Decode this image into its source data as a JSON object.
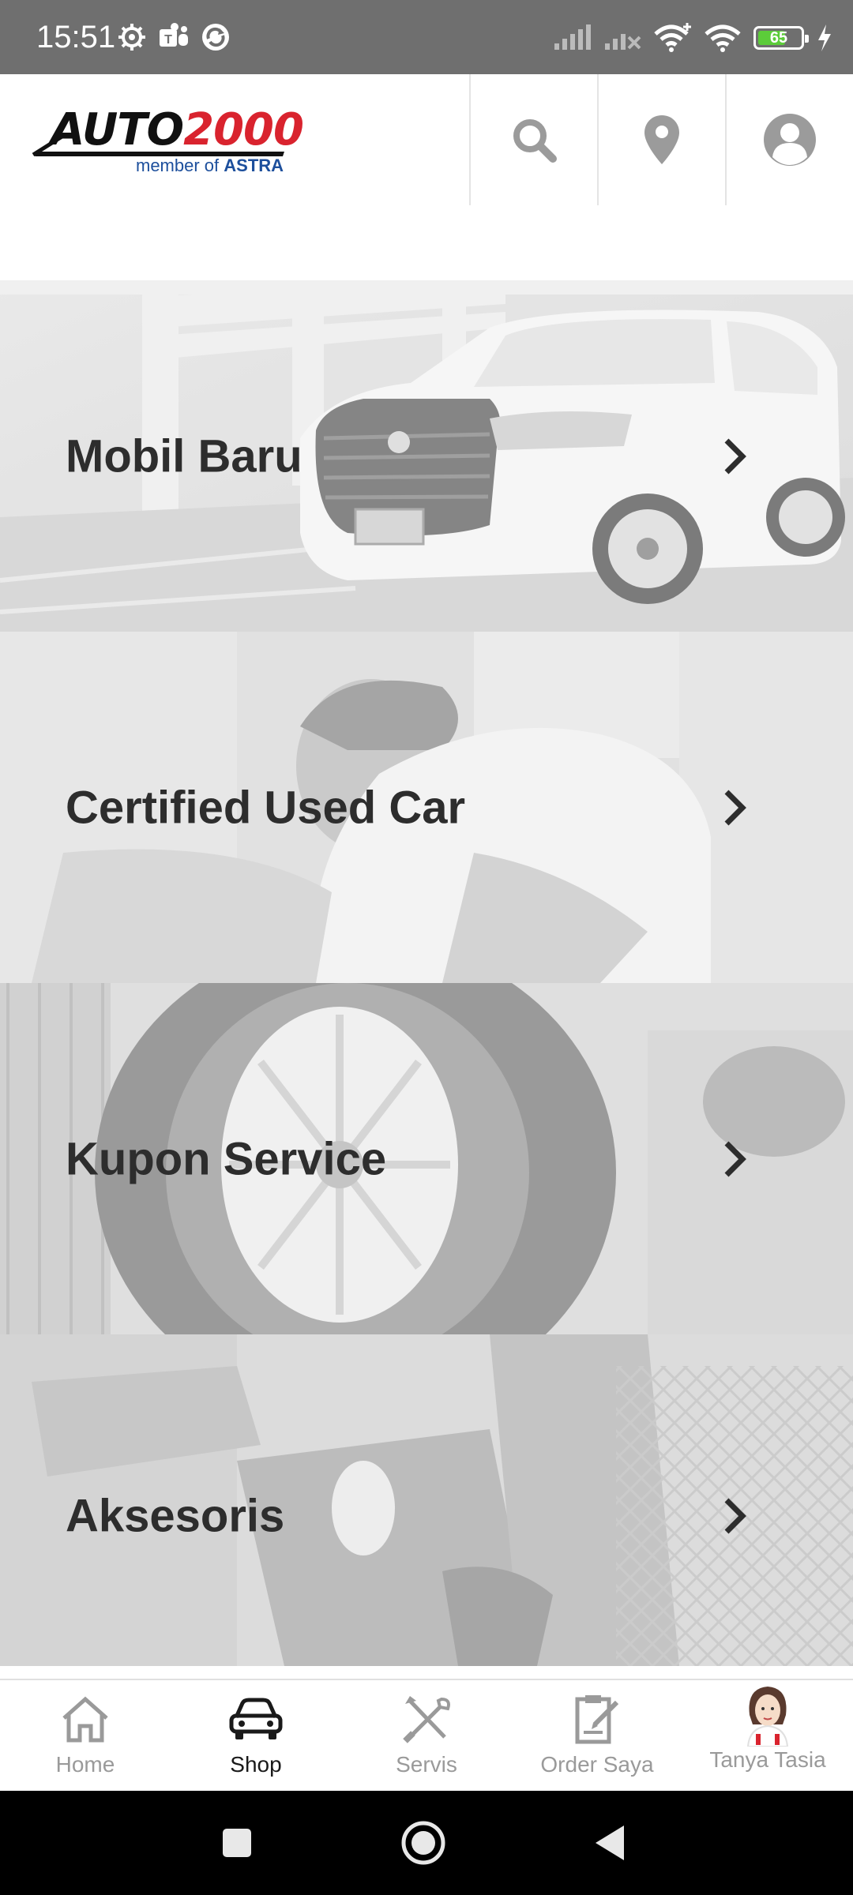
{
  "status_bar": {
    "time": "15:51",
    "battery": {
      "level_text": "65",
      "level_fraction": 0.65,
      "fill_color": "#5ccc3a"
    },
    "left_icons": [
      "settings-gear-icon",
      "teams-icon",
      "sync-app-icon"
    ],
    "right_icons": [
      "cell-signal-icon",
      "cell-signal-muted-icon",
      "wifi-plus-icon",
      "wifi-icon",
      "battery-icon",
      "charging-bolt-icon"
    ]
  },
  "header": {
    "logo": {
      "brand": "AUTO",
      "number": "2000",
      "tagline_prefix": "member of",
      "tagline_brand": "ASTRA"
    },
    "actions": [
      "search-icon",
      "location-pin-icon",
      "account-icon"
    ]
  },
  "menu": {
    "items": [
      {
        "label": "Mobil Baru"
      },
      {
        "label": "Certified Used Car"
      },
      {
        "label": "Kupon Service"
      },
      {
        "label": "Aksesoris"
      }
    ]
  },
  "bottom_nav": {
    "items": [
      {
        "label": "Home",
        "icon": "home-icon",
        "active": false
      },
      {
        "label": "Shop",
        "icon": "car-icon",
        "active": true
      },
      {
        "label": "Servis",
        "icon": "tools-icon",
        "active": false
      },
      {
        "label": "Order Saya",
        "icon": "clipboard-edit-icon",
        "active": false
      },
      {
        "label": "Tanya Tasia",
        "icon": "assistant-avatar-icon",
        "active": false
      }
    ]
  },
  "colors": {
    "brand_red": "#d9232e",
    "brand_blue": "#1d4f9c",
    "icon_gray": "#9b9b9b",
    "status_bar": "#6f6f6f",
    "label_dark": "#2d2d2d"
  }
}
